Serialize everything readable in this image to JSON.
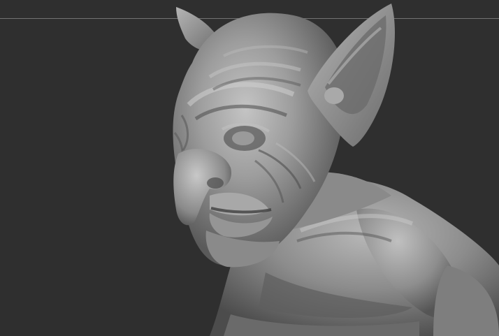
{
  "scene": {
    "background_color": "#2f2f2f",
    "guide_line_color": "#8a8a8a",
    "model_base_color": "#8e8e8e",
    "model_highlight_color": "#c8c8c8",
    "model_shadow_color": "#3c3c3c"
  }
}
